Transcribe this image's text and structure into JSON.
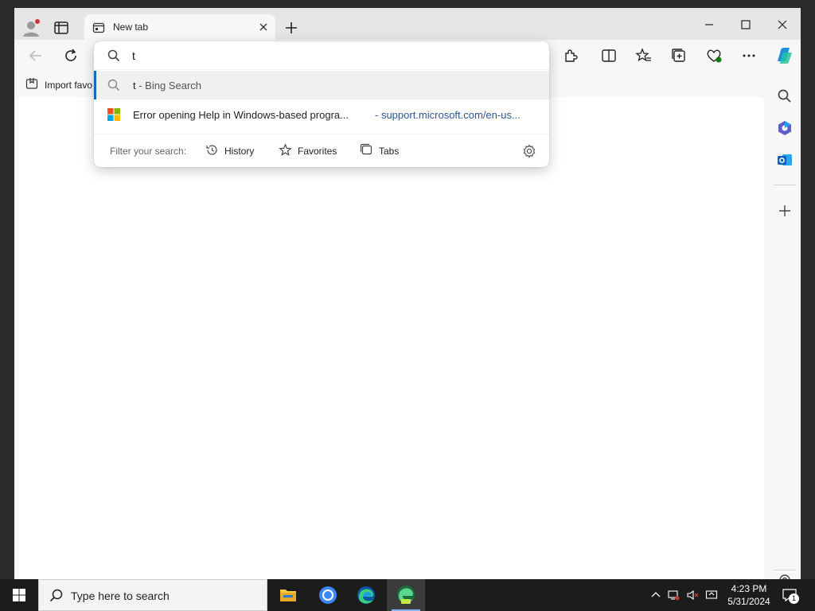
{
  "browser": {
    "tab_title": "New tab",
    "favorites_bar": {
      "import_label": "Import favo"
    }
  },
  "omnibox": {
    "query": "t",
    "suggestions": [
      {
        "text": "t",
        "suffix": " - Bing Search",
        "icon": "search-icon"
      },
      {
        "text": "Error opening Help in Windows-based progra...",
        "url": "- support.microsoft.com/en-us...",
        "icon": "microsoft-logo"
      }
    ],
    "filter": {
      "label": "Filter your search:",
      "chips": [
        "History",
        "Favorites",
        "Tabs"
      ]
    }
  },
  "taskbar": {
    "search_placeholder": "Type here to search",
    "time": "4:23 PM",
    "date": "5/31/2024",
    "notification_count": "1"
  },
  "colors": {
    "accent": "#0f6cbd",
    "taskbar": "#1c1c1c",
    "url_text": "#2b5797"
  }
}
